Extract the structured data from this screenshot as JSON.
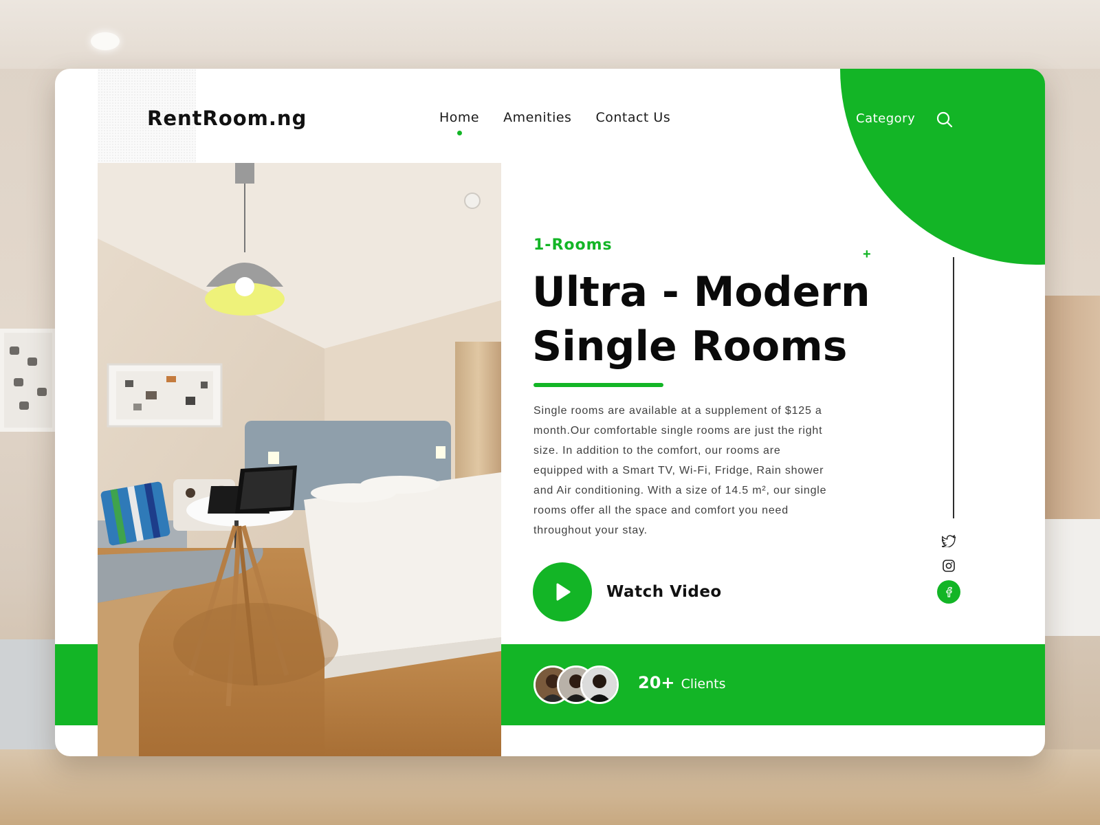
{
  "brand": {
    "name": "RentRoom.ng"
  },
  "nav": {
    "items": [
      {
        "label": "Home",
        "active": true
      },
      {
        "label": "Amenities",
        "active": false
      },
      {
        "label": "Contact Us",
        "active": false
      }
    ],
    "category_label": "Category",
    "search_icon": "search-icon"
  },
  "hero": {
    "image": "bedroom-photo",
    "kicker": "1-Rooms",
    "title_line1": "Ultra - Modern",
    "title_line2": "Single Rooms",
    "description": "Single rooms are available at a supplement of $125 a month.Our comfortable single rooms are just the right size. In addition to the comfort, our rooms are equipped with a Smart TV, Wi-Fi, Fridge, Rain shower and Air conditioning. With a size of 14.5 m², our single rooms offer all the space and comfort you need throughout your stay.",
    "watch_label": "Watch Video",
    "plus_symbol": "+"
  },
  "social": [
    "twitter-icon",
    "instagram-icon",
    "facebook-icon"
  ],
  "clients": {
    "count": "20+",
    "label": "Clients"
  },
  "colors": {
    "accent": "#13b526",
    "text": "#0a0a0a",
    "body": "#3e3e3e"
  }
}
